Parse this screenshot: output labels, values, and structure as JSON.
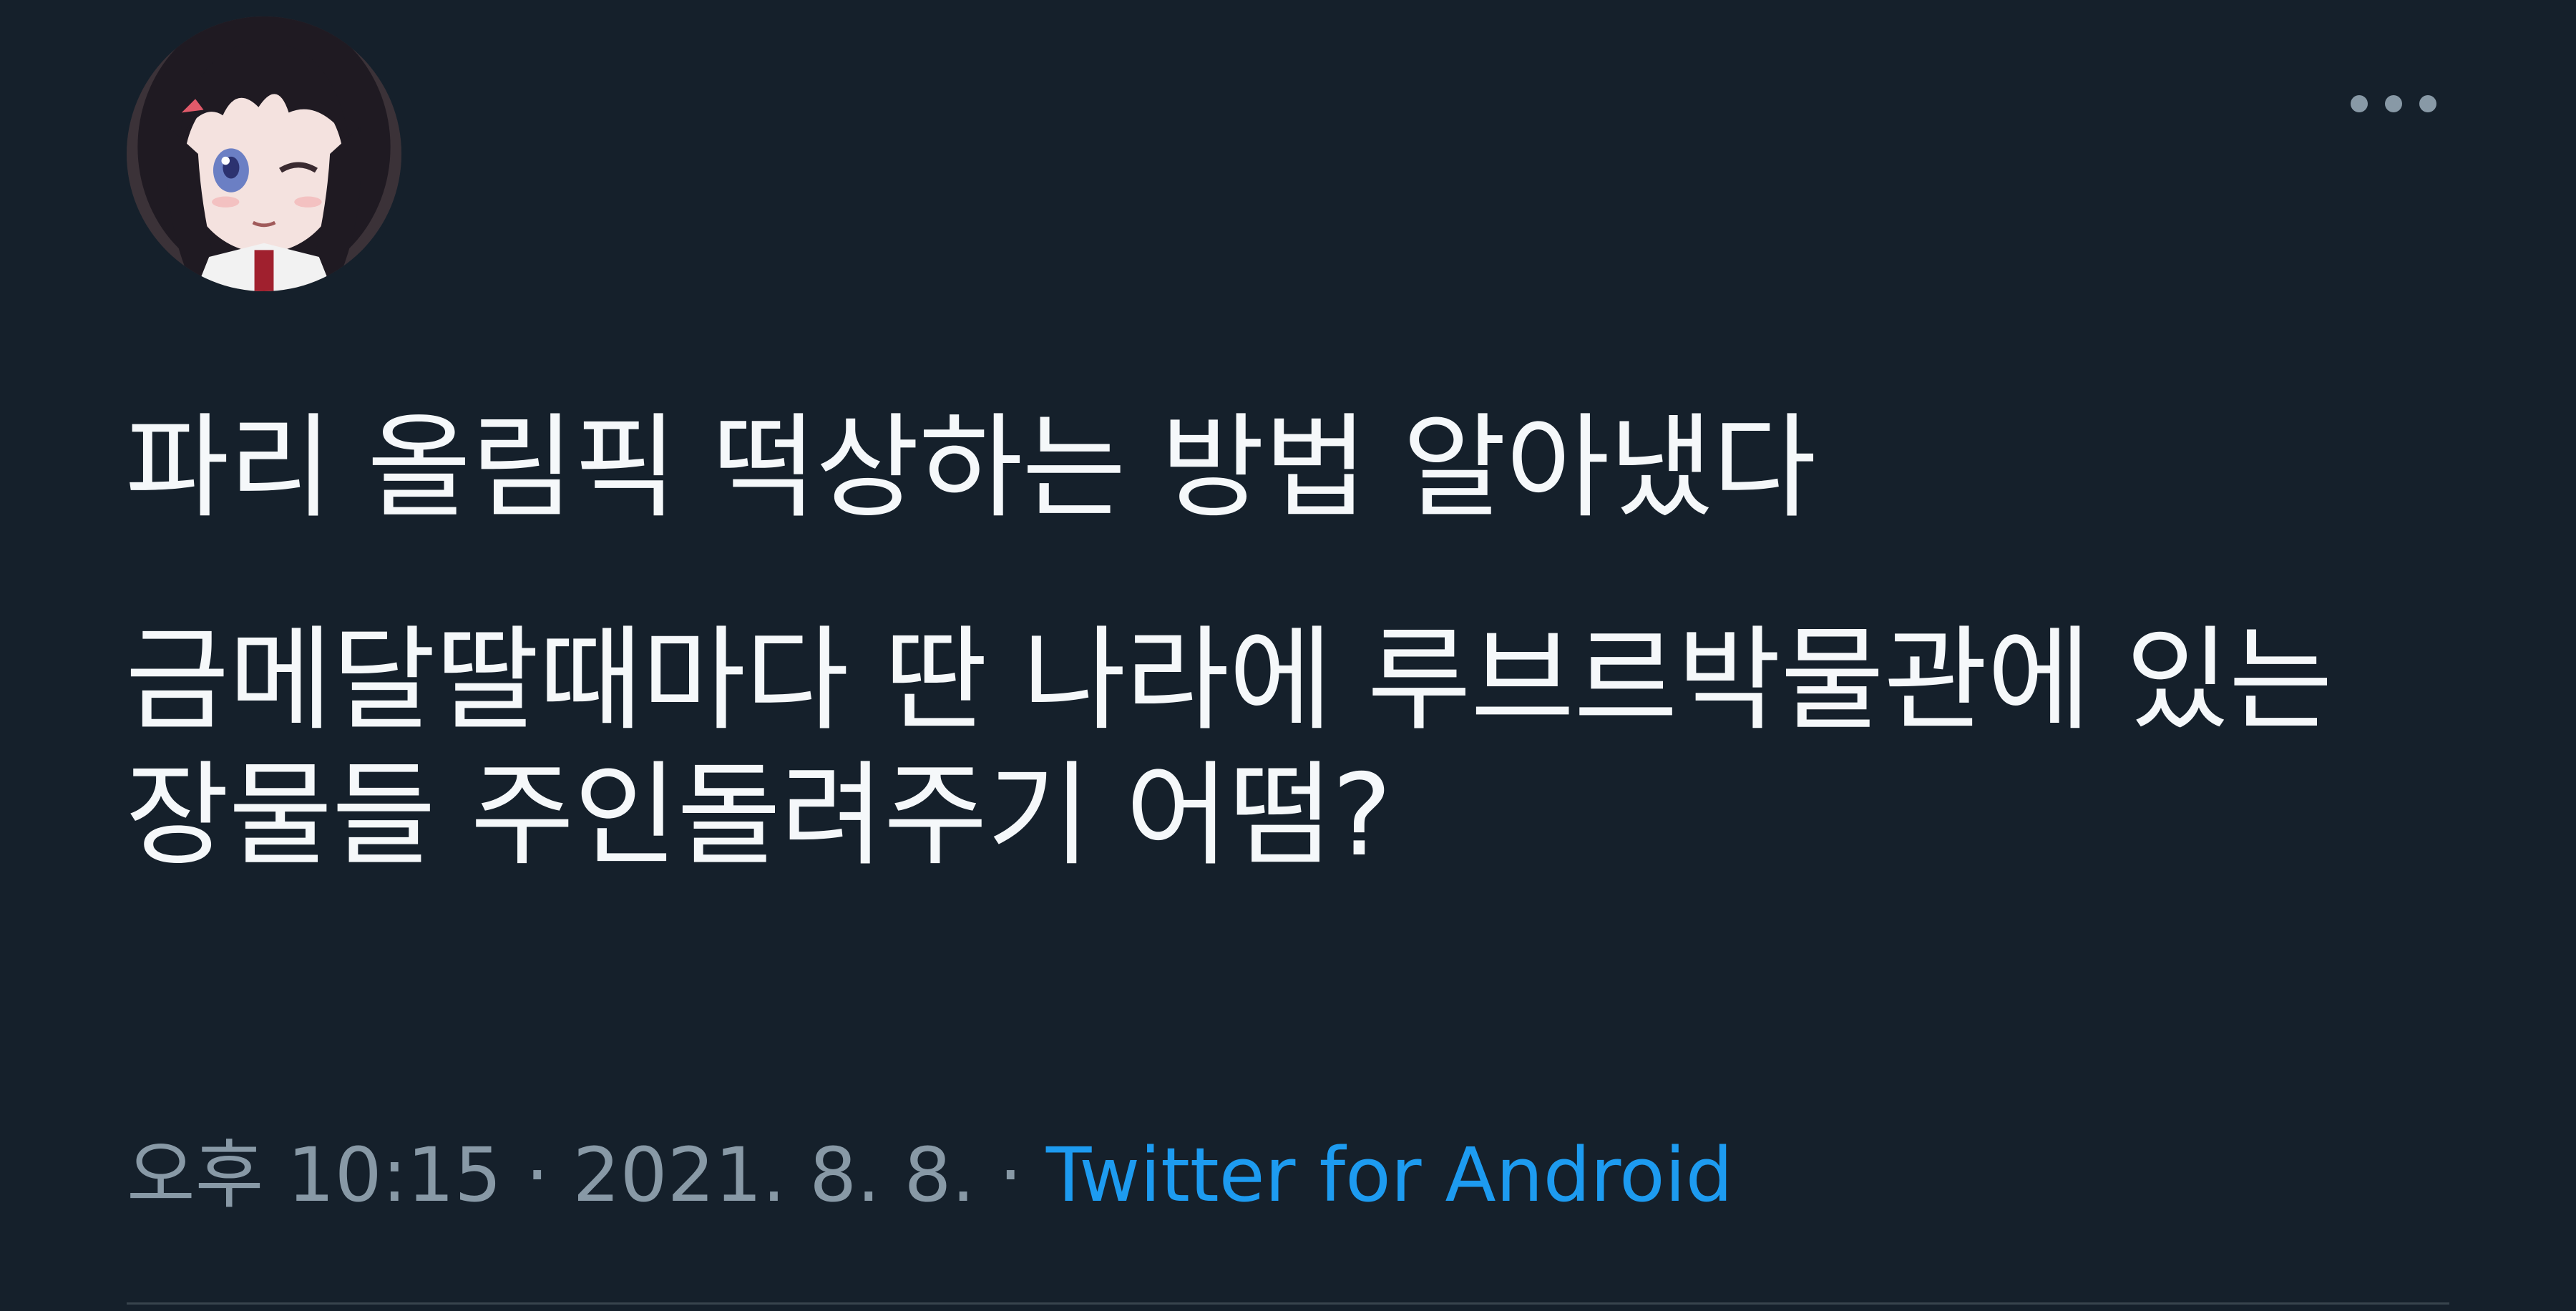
{
  "tweet": {
    "menu_icon": "more-horizontal-icon",
    "avatar_icon": "anime-girl-avatar",
    "text_lines": [
      "파리 올림픽 떡상하는 방법 알아냈다",
      "금메달딸때마다 딴 나라에 루브르박물관에 있는",
      "장물들 주인돌려주기 어떰?"
    ],
    "time": "오후 10:15",
    "separator": "·",
    "date": "2021. 8. 8.",
    "source": "Twitter for Android"
  },
  "colors": {
    "background": "#15202b",
    "text": "#f5f8fa",
    "meta": "#8899a6",
    "link": "#1d9bf0",
    "divider": "#38444d"
  }
}
